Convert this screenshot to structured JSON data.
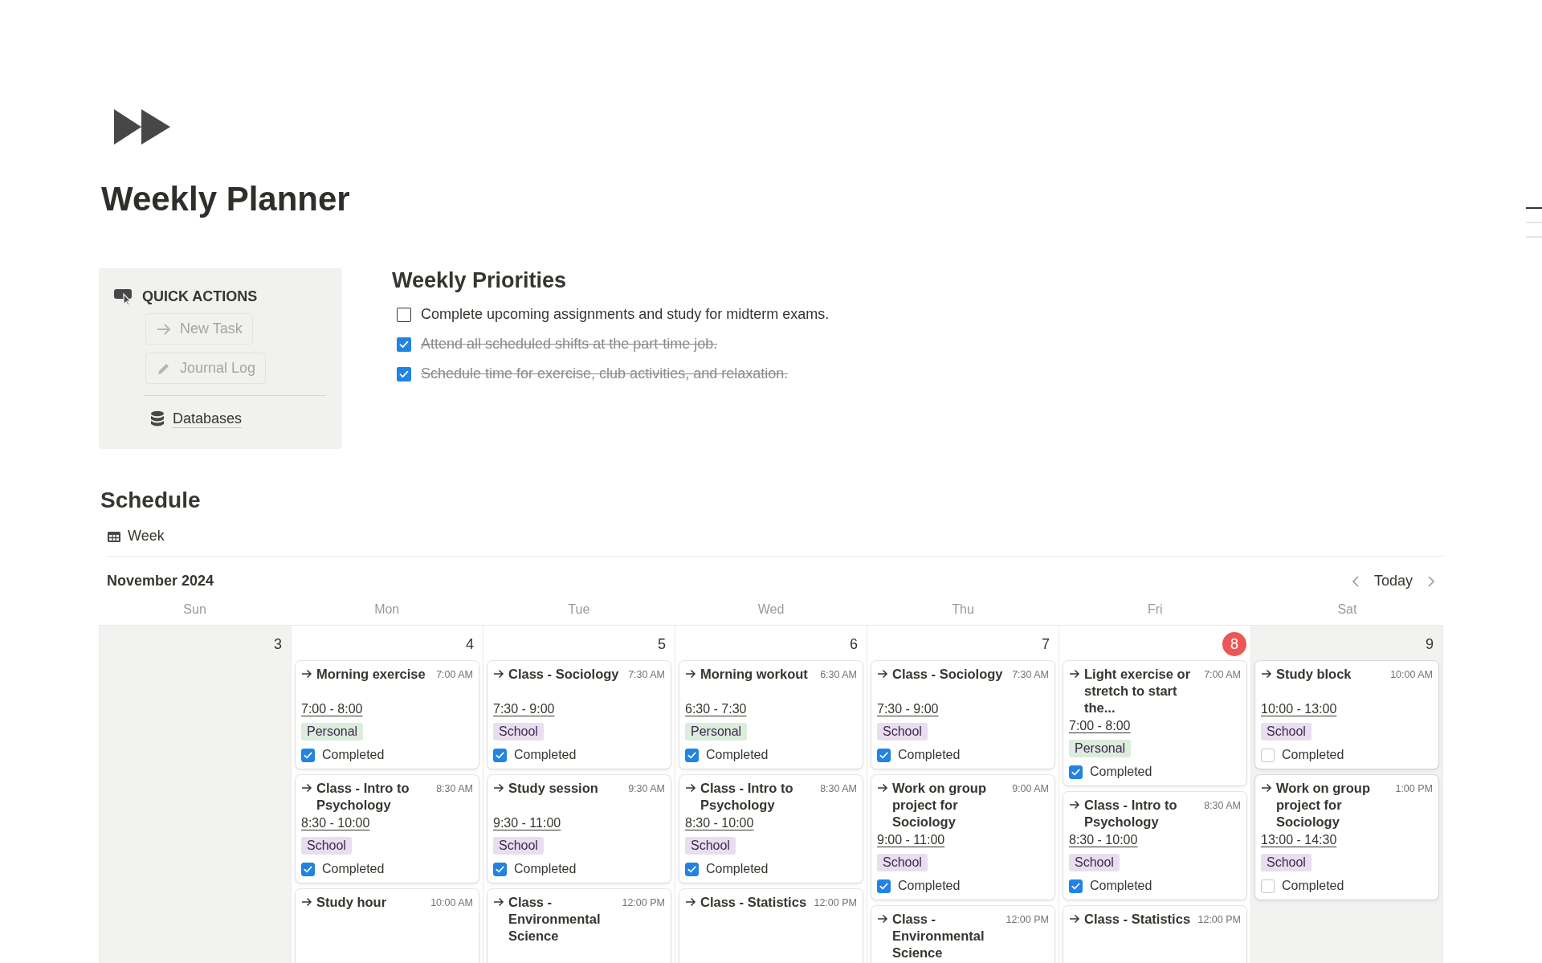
{
  "page": {
    "title": "Weekly Planner"
  },
  "quick_actions": {
    "title": "QUICK ACTIONS",
    "buttons": [
      {
        "label": "New Task",
        "kind": "arrow"
      },
      {
        "label": "Journal Log",
        "kind": "pencil"
      }
    ],
    "link": "Databases"
  },
  "priorities": {
    "title": "Weekly Priorities",
    "items": [
      {
        "text": "Complete upcoming assignments and study for midterm exams.",
        "checked": false
      },
      {
        "text": "Attend all scheduled shifts at the part-time job.",
        "checked": true
      },
      {
        "text": "Schedule time for exercise, club activities, and relaxation.",
        "checked": true
      }
    ]
  },
  "schedule": {
    "title": "Schedule",
    "view": "Week",
    "month": "November 2024",
    "today_button": "Today",
    "weekdays": [
      "Sun",
      "Mon",
      "Tue",
      "Wed",
      "Thu",
      "Fri",
      "Sat"
    ],
    "days": [
      {
        "number": "3",
        "today": false,
        "weekend": true
      },
      {
        "number": "4",
        "today": false,
        "weekend": false,
        "events": [
          {
            "title": "Morning exercise",
            "time": "7:00 AM",
            "range": "7:00 - 8:00",
            "tag": {
              "label": "Personal",
              "color": "#dbeddb"
            },
            "completed_label": "Completed",
            "completed": true
          },
          {
            "title": "Class - Intro to Psychology",
            "time": "8:30 AM",
            "range": "8:30 - 10:00",
            "tag": {
              "label": "School",
              "color": "#e8deee"
            },
            "completed_label": "Completed",
            "completed": true
          },
          {
            "title": "Study hour",
            "time": "10:00 AM"
          }
        ]
      },
      {
        "number": "5",
        "today": false,
        "weekend": false,
        "events": [
          {
            "title": "Class - Sociology",
            "time": "7:30 AM",
            "range": "7:30 - 9:00",
            "tag": {
              "label": "School",
              "color": "#e8deee"
            },
            "completed_label": "Completed",
            "completed": true
          },
          {
            "title": "Study session",
            "time": "9:30 AM",
            "range": "9:30 - 11:00",
            "tag": {
              "label": "School",
              "color": "#e8deee"
            },
            "completed_label": "Completed",
            "completed": true
          },
          {
            "title": "Class - Environmental Science",
            "time": "12:00 PM"
          }
        ]
      },
      {
        "number": "6",
        "today": false,
        "weekend": false,
        "events": [
          {
            "title": "Morning workout",
            "time": "6:30 AM",
            "range": "6:30 - 7:30",
            "tag": {
              "label": "Personal",
              "color": "#dbeddb"
            },
            "completed_label": "Completed",
            "completed": true
          },
          {
            "title": "Class - Intro to Psychology",
            "time": "8:30 AM",
            "range": "8:30 - 10:00",
            "tag": {
              "label": "School",
              "color": "#e8deee"
            },
            "completed_label": "Completed",
            "completed": true
          },
          {
            "title": "Class - Statistics",
            "time": "12:00 PM"
          }
        ]
      },
      {
        "number": "7",
        "today": false,
        "weekend": false,
        "events": [
          {
            "title": "Class - Sociology",
            "time": "7:30 AM",
            "range": "7:30 - 9:00",
            "tag": {
              "label": "School",
              "color": "#e8deee"
            },
            "completed_label": "Completed",
            "completed": true
          },
          {
            "title": "Work on group project for Sociology",
            "time": "9:00 AM",
            "range": "9:00 - 11:00",
            "tag": {
              "label": "School",
              "color": "#e8deee"
            },
            "completed_label": "Completed",
            "completed": true
          },
          {
            "title": "Class - Environmental Science",
            "time": "12:00 PM"
          }
        ]
      },
      {
        "number": "8",
        "today": true,
        "weekend": false,
        "events": [
          {
            "title": "Light exercise or stretch to start the...",
            "time": "7:00 AM",
            "range": "7:00 - 8:00",
            "tag": {
              "label": "Personal",
              "color": "#dbeddb"
            },
            "completed_label": "Completed",
            "completed": true
          },
          {
            "title": "Class - Intro to Psychology",
            "time": "8:30 AM",
            "range": "8:30 - 10:00",
            "tag": {
              "label": "School",
              "color": "#e8deee"
            },
            "completed_label": "Completed",
            "completed": true
          },
          {
            "title": "Class - Statistics",
            "time": "12:00 PM"
          }
        ]
      },
      {
        "number": "9",
        "today": false,
        "weekend": true,
        "events": [
          {
            "title": "Study block",
            "time": "10:00 AM",
            "range": "10:00 - 13:00",
            "tag": {
              "label": "School",
              "color": "#e8deee"
            },
            "completed_label": "Completed",
            "completed": false
          },
          {
            "title": "Work on group project for Sociology",
            "time": "1:00 PM",
            "range": "13:00 - 14:30",
            "tag": {
              "label": "School",
              "color": "#e8deee"
            },
            "completed_label": "Completed",
            "completed": false
          }
        ]
      }
    ]
  }
}
